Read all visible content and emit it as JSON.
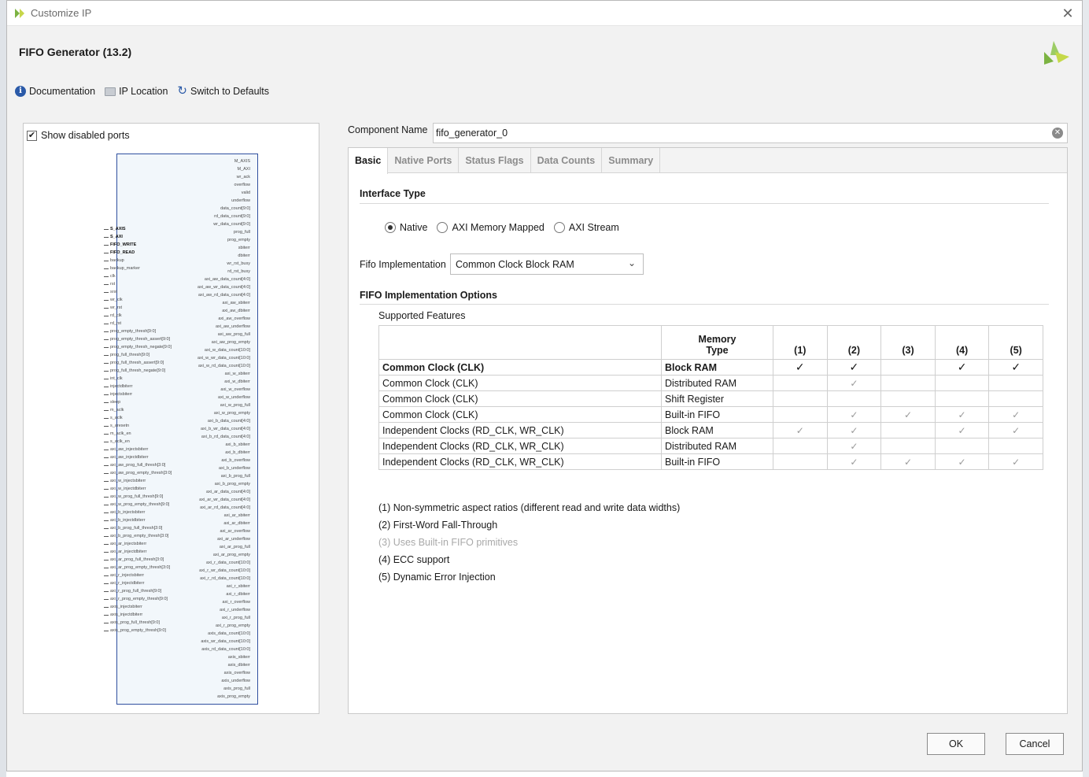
{
  "window": {
    "title": "Customize IP",
    "close_glyph": "✕"
  },
  "header": {
    "title": "FIFO Generator (13.2)"
  },
  "toolbar": {
    "documentation": "Documentation",
    "ip_location": "IP Location",
    "switch_defaults": "Switch to Defaults"
  },
  "left_panel": {
    "show_disabled_ports": "Show disabled ports",
    "show_disabled_checked": true,
    "left_ports": [
      "S_AXIS",
      "S_AXI",
      "FIFO_WRITE",
      "FIFO_READ",
      "backup",
      "backup_marker",
      "clk",
      "rst",
      "srst",
      "wr_clk",
      "wr_rst",
      "rd_clk",
      "rd_rst",
      "prog_empty_thresh[9:0]",
      "prog_empty_thresh_assert[9:0]",
      "prog_empty_thresh_negate[9:0]",
      "prog_full_thresh[9:0]",
      "prog_full_thresh_assert[9:0]",
      "prog_full_thresh_negate[9:0]",
      "int_clk",
      "injectdbiterr",
      "injectsbiterr",
      "sleep",
      "m_aclk",
      "s_aclk",
      "s_aresetn",
      "m_aclk_en",
      "s_aclk_en",
      "axi_aw_injectsbiterr",
      "axi_aw_injectdbiterr",
      "axi_aw_prog_full_thresh[3:0]",
      "axi_aw_prog_empty_thresh[3:0]",
      "axi_w_injectsbiterr",
      "axi_w_injectdbiterr",
      "axi_w_prog_full_thresh[9:0]",
      "axi_w_prog_empty_thresh[9:0]",
      "axi_b_injectsbiterr",
      "axi_b_injectdbiterr",
      "axi_b_prog_full_thresh[3:0]",
      "axi_b_prog_empty_thresh[3:0]",
      "axi_ar_injectsbiterr",
      "axi_ar_injectdbiterr",
      "axi_ar_prog_full_thresh[3:0]",
      "axi_ar_prog_empty_thresh[3:0]",
      "axi_r_injectsbiterr",
      "axi_r_injectdbiterr",
      "axi_r_prog_full_thresh[9:0]",
      "axi_r_prog_empty_thresh[9:0]",
      "axis_injectsbiterr",
      "axis_injectdbiterr",
      "axis_prog_full_thresh[9:0]",
      "axis_prog_empty_thresh[9:0]"
    ],
    "right_ports": [
      "M_AXIS",
      "M_AXI",
      "wr_ack",
      "overflow",
      "valid",
      "underflow",
      "data_count[9:0]",
      "rd_data_count[9:0]",
      "wr_data_count[9:0]",
      "prog_full",
      "prog_empty",
      "sbiterr",
      "dbiterr",
      "wr_rst_busy",
      "rd_rst_busy",
      "axi_aw_data_count[4:0]",
      "axi_aw_wr_data_count[4:0]",
      "axi_aw_rd_data_count[4:0]",
      "axi_aw_sbiterr",
      "axi_aw_dbiterr",
      "axi_aw_overflow",
      "axi_aw_underflow",
      "axi_aw_prog_full",
      "axi_aw_prog_empty",
      "axi_w_data_count[10:0]",
      "axi_w_wr_data_count[10:0]",
      "axi_w_rd_data_count[10:0]",
      "axi_w_sbiterr",
      "axi_w_dbiterr",
      "axi_w_overflow",
      "axi_w_underflow",
      "axi_w_prog_full",
      "axi_w_prog_empty",
      "axi_b_data_count[4:0]",
      "axi_b_wr_data_count[4:0]",
      "axi_b_rd_data_count[4:0]",
      "axi_b_sbiterr",
      "axi_b_dbiterr",
      "axi_b_overflow",
      "axi_b_underflow",
      "axi_b_prog_full",
      "axi_b_prog_empty",
      "axi_ar_data_count[4:0]",
      "axi_ar_wr_data_count[4:0]",
      "axi_ar_rd_data_count[4:0]",
      "axi_ar_sbiterr",
      "axi_ar_dbiterr",
      "axi_ar_overflow",
      "axi_ar_underflow",
      "axi_ar_prog_full",
      "axi_ar_prog_empty",
      "axi_r_data_count[10:0]",
      "axi_r_wr_data_count[10:0]",
      "axi_r_rd_data_count[10:0]",
      "axi_r_sbiterr",
      "axi_r_dbiterr",
      "axi_r_overflow",
      "axi_r_underflow",
      "axi_r_prog_full",
      "axi_r_prog_empty",
      "axis_data_count[10:0]",
      "axis_wr_data_count[10:0]",
      "axis_rd_data_count[10:0]",
      "axis_sbiterr",
      "axis_dbiterr",
      "axis_overflow",
      "axis_underflow",
      "axis_prog_full",
      "axis_prog_empty"
    ]
  },
  "component": {
    "label": "Component Name",
    "value": "fifo_generator_0"
  },
  "tabs": [
    "Basic",
    "Native Ports",
    "Status Flags",
    "Data Counts",
    "Summary"
  ],
  "basic": {
    "interface_type_title": "Interface Type",
    "interface_options": [
      "Native",
      "AXI Memory Mapped",
      "AXI Stream"
    ],
    "interface_selected": "Native",
    "fifo_impl_label": "Fifo Implementation",
    "fifo_impl_value": "Common Clock Block RAM",
    "impl_options_title": "FIFO Implementation Options",
    "supported_features": "Supported Features",
    "table": {
      "memory_type_header": [
        "Memory",
        "Type"
      ],
      "feature_headers": [
        "(1)",
        "(2)",
        "(3)",
        "(4)",
        "(5)"
      ],
      "rows": [
        {
          "clock": "Common Clock (CLK)",
          "memory": "Block RAM",
          "checks": [
            1,
            1,
            0,
            1,
            1
          ]
        },
        {
          "clock": "Common Clock (CLK)",
          "memory": "Distributed RAM",
          "checks": [
            0,
            1,
            0,
            0,
            0
          ]
        },
        {
          "clock": "Common Clock (CLK)",
          "memory": "Shift Register",
          "checks": [
            0,
            0,
            0,
            0,
            0
          ]
        },
        {
          "clock": "Common Clock (CLK)",
          "memory": "Built-in FIFO",
          "checks": [
            0,
            1,
            1,
            1,
            1
          ]
        },
        {
          "clock": "Independent Clocks (RD_CLK, WR_CLK)",
          "memory": "Block RAM",
          "checks": [
            1,
            1,
            0,
            1,
            1
          ]
        },
        {
          "clock": "Independent Clocks (RD_CLK, WR_CLK)",
          "memory": "Distributed RAM",
          "checks": [
            0,
            1,
            0,
            0,
            0
          ]
        },
        {
          "clock": "Independent Clocks (RD_CLK, WR_CLK)",
          "memory": "Built-in FIFO",
          "checks": [
            0,
            1,
            1,
            1,
            1
          ]
        }
      ]
    },
    "notes": [
      {
        "text": "(1) Non-symmetric aspect ratios (different read and write data widths)",
        "disabled": false
      },
      {
        "text": "(2) First-Word Fall-Through",
        "disabled": false
      },
      {
        "text": "(3) Uses Built-in FIFO primitives",
        "disabled": true
      },
      {
        "text": "(4) ECC support",
        "disabled": false
      },
      {
        "text": "(5) Dynamic Error Injection",
        "disabled": false
      }
    ]
  },
  "buttons": {
    "ok": "OK",
    "cancel": "Cancel"
  },
  "colors": {
    "accent": "#2b5aa8",
    "logo": "#7cb342",
    "symbol_border": "#2f4f9f"
  }
}
